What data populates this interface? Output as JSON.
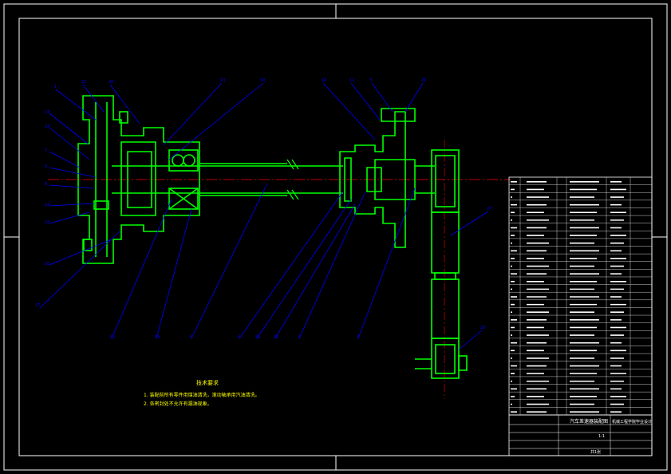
{
  "drawing": {
    "title": "",
    "notes_heading": "技术要求",
    "notes": [
      "1. 装配前所有零件用煤油清洗，滚动轴承用汽油清洗。",
      "2. 各密封处不允许有漏油现象。"
    ],
    "title_block": {
      "name": "汽车差速器装配图",
      "school": "机械工程学院毕业设计",
      "scale": "1:1",
      "sheet": "共1张"
    },
    "balloons": [
      "1",
      "22",
      "20",
      "23",
      "24",
      "7",
      "6",
      "8",
      "14",
      "15",
      "16",
      "17",
      "13",
      "18",
      "12",
      "19",
      "9",
      "4",
      "25",
      "21",
      "3",
      "10",
      "11",
      "5",
      "26",
      "2",
      "27",
      "28"
    ]
  },
  "colors": {
    "background": "#000000",
    "frame": "#ffffff",
    "part": "#00ff00",
    "leader": "#0000ff",
    "centerline": "#ff0000",
    "note": "#ffff00"
  }
}
